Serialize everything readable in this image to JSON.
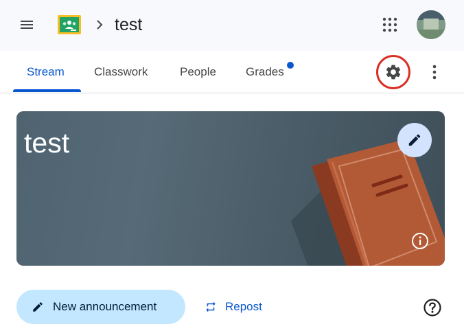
{
  "header": {
    "course_title": "test",
    "logo_icon": "google-classroom-logo",
    "menu_icon": "hamburger-menu-icon",
    "apps_icon": "apps-grid-icon",
    "breadcrumb_separator_icon": "chevron-right-icon"
  },
  "tabs": [
    {
      "label": "Stream",
      "active": true
    },
    {
      "label": "Classwork",
      "active": false
    },
    {
      "label": "People",
      "active": false
    },
    {
      "label": "Grades",
      "active": false,
      "notification_dot": true
    }
  ],
  "toolbar": {
    "settings_icon": "gear-icon",
    "more_icon": "more-vert-icon"
  },
  "banner": {
    "title": "test",
    "edit_icon": "pencil-icon",
    "info_icon": "info-icon"
  },
  "actions": {
    "new_announcement_label": "New announcement",
    "repost_label": "Repost",
    "help_icon": "help-circle-icon"
  },
  "colors": {
    "accent": "#0b57d0",
    "highlight_ring": "#d93025",
    "announcement_button_bg": "#c2e7ff",
    "edit_button_bg": "#d3e3fd"
  }
}
